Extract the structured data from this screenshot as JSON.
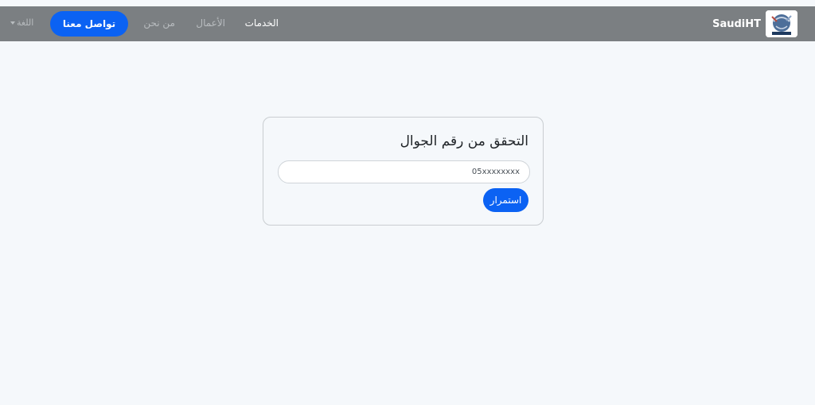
{
  "navbar": {
    "brand_name": "SaudiHT",
    "logo_icon": "saudiht-logo",
    "links": {
      "services": "الخدمات",
      "works": "الأعمال",
      "about": "من نحن"
    },
    "contact_button": "تواصل معنا",
    "language_label": "اللغة",
    "background_color": "#7b7f82",
    "accent_color": "#0b62f3"
  },
  "verification": {
    "title": "التحقق من رقم الجوال",
    "phone_value": "05xxxxxxxx",
    "submit_label": "استمرار"
  }
}
